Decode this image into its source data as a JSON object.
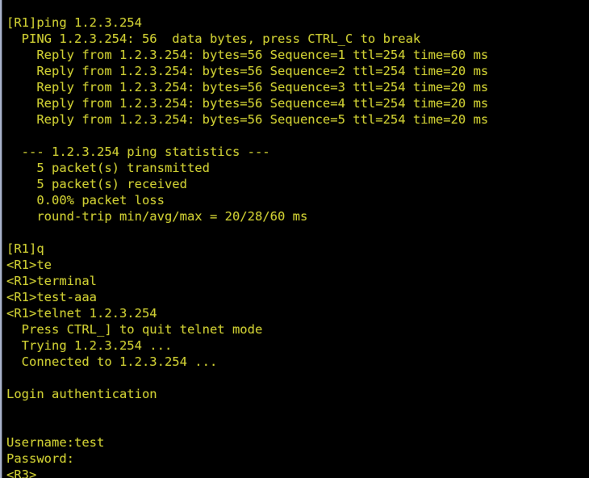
{
  "terminal": {
    "background_color": "#000000",
    "text_color": "#cccc33",
    "border_color": "#aab3cb",
    "lines": [
      "[R1]ping 1.2.3.254",
      "  PING 1.2.3.254: 56  data bytes, press CTRL_C to break",
      "    Reply from 1.2.3.254: bytes=56 Sequence=1 ttl=254 time=60 ms",
      "    Reply from 1.2.3.254: bytes=56 Sequence=2 ttl=254 time=20 ms",
      "    Reply from 1.2.3.254: bytes=56 Sequence=3 ttl=254 time=20 ms",
      "    Reply from 1.2.3.254: bytes=56 Sequence=4 ttl=254 time=20 ms",
      "    Reply from 1.2.3.254: bytes=56 Sequence=5 ttl=254 time=20 ms",
      "",
      "  --- 1.2.3.254 ping statistics ---",
      "    5 packet(s) transmitted",
      "    5 packet(s) received",
      "    0.00% packet loss",
      "    round-trip min/avg/max = 20/28/60 ms",
      "",
      "[R1]q",
      "<R1>te",
      "<R1>terminal",
      "<R1>test-aaa",
      "<R1>telnet 1.2.3.254",
      "  Press CTRL_] to quit telnet mode",
      "  Trying 1.2.3.254 ...",
      "  Connected to 1.2.3.254 ...",
      "",
      "Login authentication",
      "",
      "",
      "Username:test",
      "Password:",
      "<R3>"
    ]
  }
}
